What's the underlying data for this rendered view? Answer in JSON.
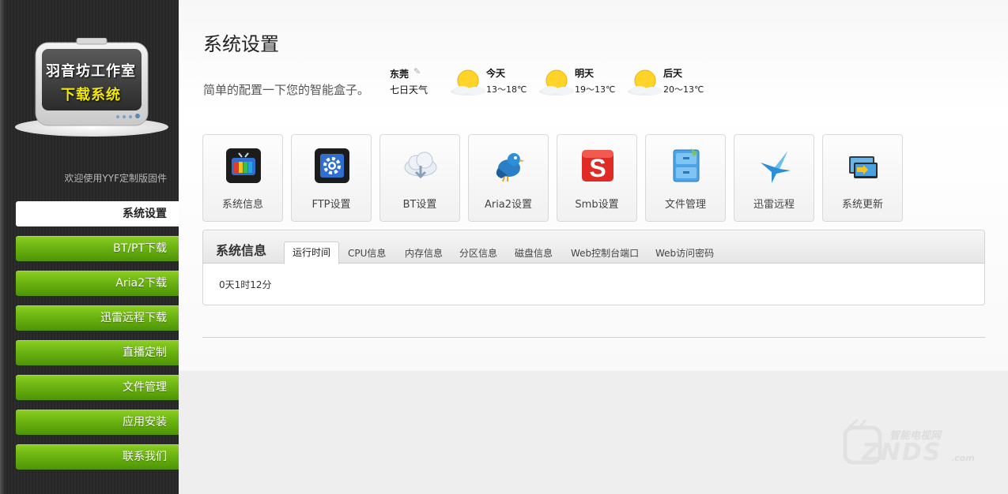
{
  "logo": {
    "line1": "羽音坊工作室",
    "line2": "下载系统"
  },
  "sidebar": {
    "welcome": "欢迎使用YYF定制版固件",
    "items": [
      {
        "label": "系统设置",
        "active": true
      },
      {
        "label": "BT/PT下载"
      },
      {
        "label": "Aria2下载"
      },
      {
        "label": "迅雷远程下载"
      },
      {
        "label": "直播定制"
      },
      {
        "label": "文件管理"
      },
      {
        "label": "应用安装"
      },
      {
        "label": "联系我们"
      }
    ]
  },
  "header": {
    "title": "系统设置",
    "subtitle": "简单的配置一下您的智能盒子。"
  },
  "weather": {
    "city": "东莞",
    "seven_day": "七日天气",
    "days": [
      {
        "label": "今天",
        "temp": "13～18℃",
        "icon": "sunny-icon"
      },
      {
        "label": "明天",
        "temp": "19～13℃",
        "icon": "sunny-icon"
      },
      {
        "label": "后天",
        "temp": "20～13℃",
        "icon": "sunny-icon"
      }
    ]
  },
  "tiles": [
    {
      "label": "系统信息",
      "icon": "tv-icon"
    },
    {
      "label": "FTP设置",
      "icon": "gear-icon"
    },
    {
      "label": "BT设置",
      "icon": "cloud-icon"
    },
    {
      "label": "Aria2设置",
      "icon": "bird-icon"
    },
    {
      "label": "Smb设置",
      "icon": "smb-icon"
    },
    {
      "label": "文件管理",
      "icon": "folder-cabinet-icon"
    },
    {
      "label": "迅雷远程",
      "icon": "thunder-bird-icon"
    },
    {
      "label": "系统更新",
      "icon": "monitor-update-icon"
    }
  ],
  "info_panel": {
    "title": "系统信息",
    "tabs": [
      "运行时间",
      "CPU信息",
      "内存信息",
      "分区信息",
      "磁盘信息",
      "Web控制台端口",
      "Web访问密码"
    ],
    "active_tab": 0,
    "content": "0天1时12分"
  },
  "watermark": {
    "line1": "智能电视网",
    "line2": "ZNDS",
    "line3": ".com"
  },
  "colors": {
    "nav_green": "#6bb412",
    "sidebar_dark": "#282828",
    "logo_yellow": "#f2e800"
  }
}
